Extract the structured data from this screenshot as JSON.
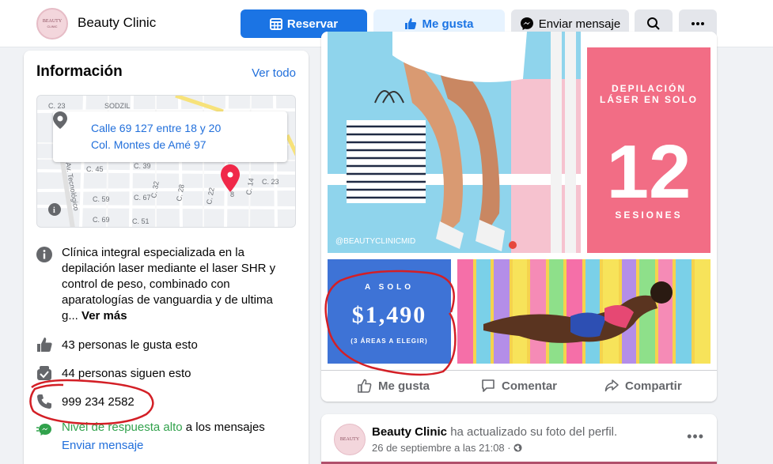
{
  "header": {
    "page_name": "Beauty Clinic",
    "logo_text": "BEAUTY",
    "logo_sub": "CLINIC",
    "reservar_label": "Reservar",
    "megusta_label": "Me gusta",
    "mensaje_label": "Enviar mensaje"
  },
  "info": {
    "title": "Información",
    "see_all": "Ver todo",
    "address_line1": "Calle 69 127 entre 18 y 20",
    "address_line2": "Col. Montes de Amé 97",
    "map_labels": [
      "C. 23",
      "SODZIL",
      "C. 45",
      "C. 39",
      "C. 59",
      "C. 67",
      "C. 32",
      "C. 28",
      "C. 22",
      "C. 14",
      "C. 23",
      "C. 69",
      "C. 51",
      "Av. Tecnológico",
      "8"
    ],
    "description": "Clínica integral especializada en la depilación laser mediante el laser SHR y control de peso, combinado con aparatologías de vanguardia y de ultima g...",
    "see_more": "Ver más",
    "likes": "43 personas le gusta esto",
    "followers": "44 personas siguen esto",
    "phone": "999 234 2582",
    "response_highlight": "Nivel de respuesta alto",
    "response_rest": " a los mensajes",
    "send_message": "Enviar mensaje"
  },
  "post": {
    "promo_title": "DEPILACIÓN LÁSER EN SOLO",
    "promo_number": "12",
    "promo_sessions": "SESIONES",
    "price_label": "A SOLO",
    "price": "$1,490",
    "price_note": "(3 ÁREAS A ELEGIR)",
    "handle": "@BEAUTYCLINICMID",
    "like": "Me gusta",
    "comment": "Comentar",
    "share": "Compartir"
  },
  "post2": {
    "author": "Beauty Clinic",
    "action": " ha actualizado su foto del perfil.",
    "date": "26 de septiembre a las 21:08 ·"
  },
  "colors": {
    "accent": "#1b74e4",
    "promo_pink": "#f26d85",
    "promo_blue": "#3e73d6",
    "sky": "#8fd4ec",
    "annotation_red": "#d31f26"
  }
}
